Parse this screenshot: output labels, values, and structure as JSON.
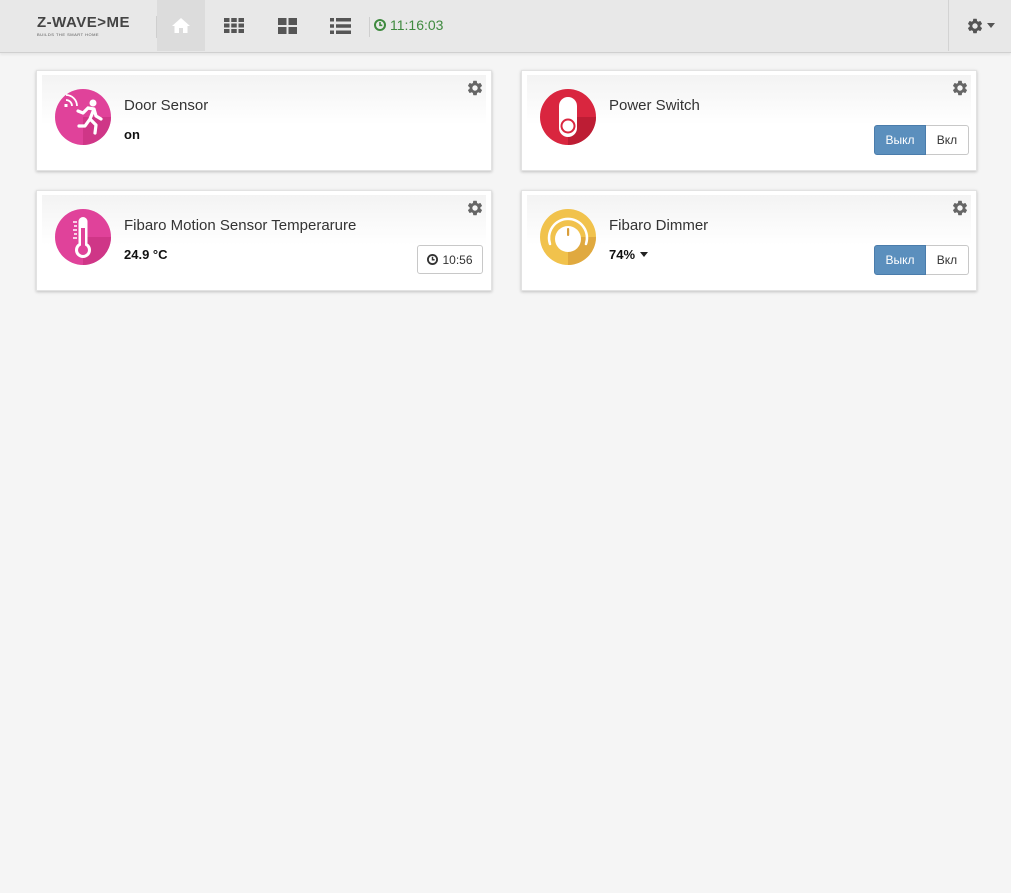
{
  "header": {
    "logo_text": "Z-WAVE>ME",
    "logo_tagline": "BUILDS THE SMART HOME",
    "nav": [
      {
        "icon": "home-icon",
        "active": true
      },
      {
        "icon": "grid-icon",
        "active": false
      },
      {
        "icon": "tiles-icon",
        "active": false
      },
      {
        "icon": "list-icon",
        "active": false
      }
    ],
    "clock_icon": "clock-icon",
    "time": "11:16:03",
    "settings_icon": "gear-icon"
  },
  "colors": {
    "clock_green": "#3f8a3f",
    "button_blue": "#5b8fbd",
    "sensor_pink": "#e0429a",
    "switch_red": "#d9263f",
    "dimmer_yellow": "#f1c24c"
  },
  "widgets": [
    {
      "id": "door-sensor",
      "title": "Door Sensor",
      "value": "on",
      "icon": "motion-running-icon"
    },
    {
      "id": "power-switch",
      "title": "Power Switch",
      "icon": "switch-toggle-icon",
      "off_label": "Выкл",
      "on_label": "Вкл"
    },
    {
      "id": "temperature",
      "title": "Fibaro Motion Sensor Temperarure",
      "value": "24.9 °C",
      "icon": "thermometer-icon",
      "time": "10:56"
    },
    {
      "id": "dimmer",
      "title": "Fibaro Dimmer",
      "value": "74%",
      "icon": "dimmer-knob-icon",
      "off_label": "Выкл",
      "on_label": "Вкл"
    }
  ]
}
